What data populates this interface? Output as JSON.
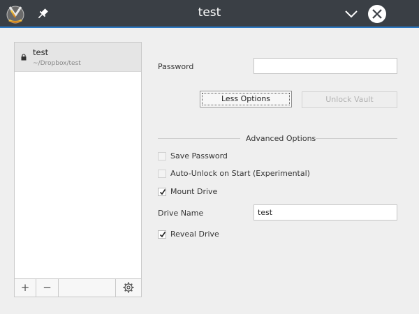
{
  "window": {
    "title": "test",
    "accent_color": "#2b78c2",
    "titlebar_color": "#3a3f45",
    "icons": [
      "app-logo-icon",
      "pin-icon",
      "chevron-down-icon",
      "close-icon"
    ]
  },
  "vaults": {
    "items": [
      {
        "name": "test",
        "path": "~/Dropbox/test",
        "icon": "lock-icon",
        "selected": true
      }
    ],
    "toolbar": {
      "add_label": "+",
      "remove_label": "−",
      "settings_icon": "gear-icon"
    }
  },
  "unlock": {
    "password_label": "Password",
    "password_value": "",
    "less_options_label": "Less Options",
    "unlock_vault_label": "Unlock Vault"
  },
  "advanced": {
    "title": "Advanced Options",
    "save_password": {
      "label": "Save Password",
      "checked": false,
      "enabled": false
    },
    "auto_unlock": {
      "label": "Auto-Unlock on Start (Experimental)",
      "checked": false,
      "enabled": false
    },
    "mount_drive": {
      "label": "Mount Drive",
      "checked": true,
      "enabled": true
    },
    "drive_name_label": "Drive Name",
    "drive_name_value": "test",
    "reveal_drive": {
      "label": "Reveal Drive",
      "checked": true,
      "enabled": true
    }
  }
}
